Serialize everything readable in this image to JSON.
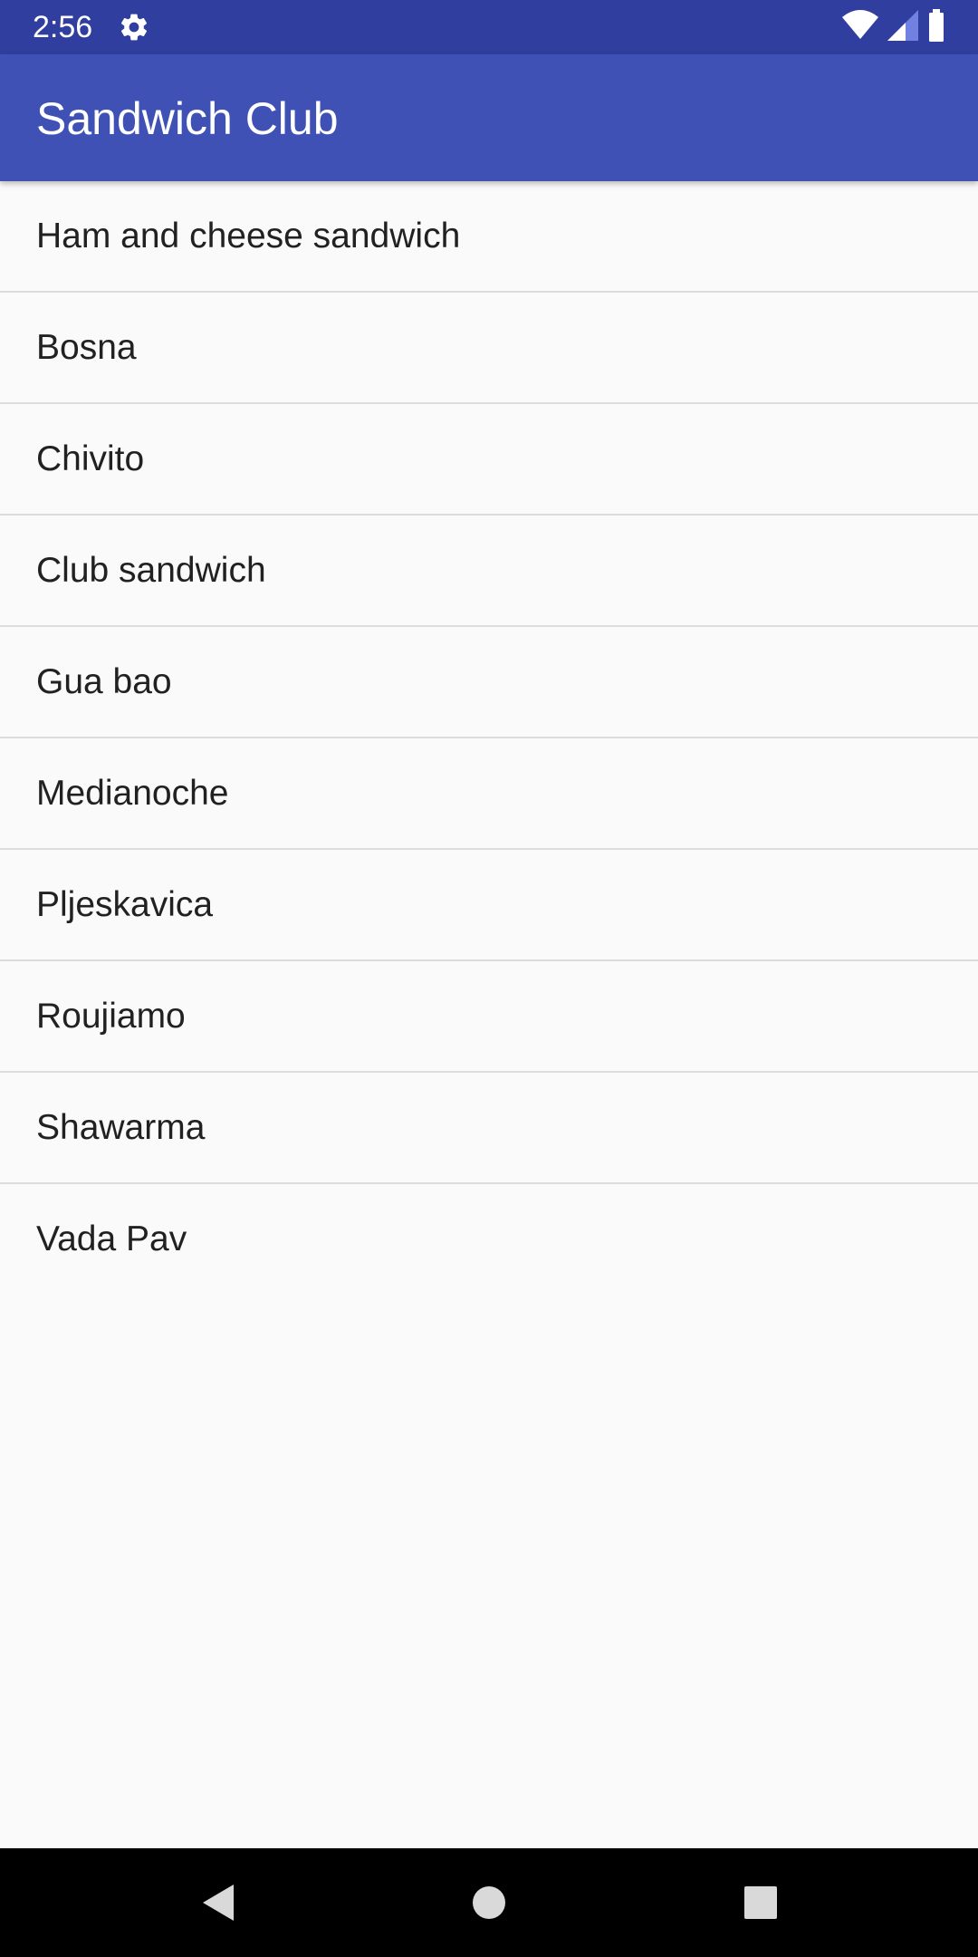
{
  "status_bar": {
    "time": "2:56",
    "settings_icon": "gear-icon",
    "wifi_icon": "wifi-icon",
    "signal_icon": "cell-signal-icon",
    "battery_icon": "battery-icon"
  },
  "app_bar": {
    "title": "Sandwich Club"
  },
  "sandwiches": [
    {
      "label": "Ham and cheese sandwich"
    },
    {
      "label": "Bosna"
    },
    {
      "label": "Chivito"
    },
    {
      "label": "Club sandwich"
    },
    {
      "label": "Gua bao"
    },
    {
      "label": "Medianoche"
    },
    {
      "label": "Pljeskavica"
    },
    {
      "label": "Roujiamo"
    },
    {
      "label": "Shawarma"
    },
    {
      "label": "Vada Pav"
    }
  ],
  "nav_bar": {
    "back_icon": "back-triangle-icon",
    "home_icon": "home-circle-icon",
    "recents_icon": "recents-square-icon"
  },
  "colors": {
    "primary": "#3f51b5",
    "primary_dark": "#303f9f",
    "background": "#fafafa",
    "divider": "#dcdcdc",
    "text": "#212121"
  }
}
